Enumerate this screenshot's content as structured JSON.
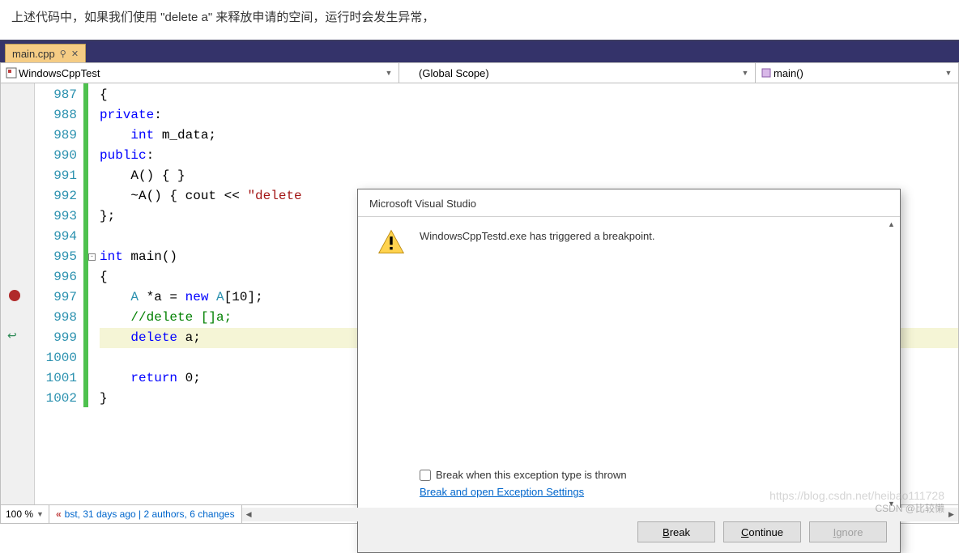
{
  "caption": "上述代码中，如果我们使用 \"delete a\" 来释放申请的空间，运行时会发生异常，",
  "tab": {
    "name": "main.cpp",
    "pin": "‫",
    "close": "✕"
  },
  "context": {
    "project_icon": "▣",
    "project": "WindowsCppTest",
    "scope": "(Global Scope)",
    "func_icon": "◈",
    "func": "main()"
  },
  "gutter": {
    "breakpoint_line": 997,
    "return_line": 999,
    "first_line": 987
  },
  "code_lines": [
    {
      "n": 987,
      "html": "{"
    },
    {
      "n": 988,
      "html": "<span class='kw'>private</span>:"
    },
    {
      "n": 989,
      "html": "    <span class='kw'>int</span> m_data;"
    },
    {
      "n": 990,
      "html": "<span class='kw'>public</span>:"
    },
    {
      "n": 991,
      "html": "    A() { }"
    },
    {
      "n": 992,
      "html": "    ~A() { cout << <span class='str'>\"delete</span>"
    },
    {
      "n": 993,
      "html": "};"
    },
    {
      "n": 994,
      "html": ""
    },
    {
      "n": 995,
      "html": "<span class='kw'>int</span> main()",
      "outline": "⊟"
    },
    {
      "n": 996,
      "html": "{"
    },
    {
      "n": 997,
      "html": "    <span class='type'>A</span> *a = <span class='kw'>new</span> <span class='type'>A</span>[10];"
    },
    {
      "n": 998,
      "html": "    <span class='cm'>//delete []a;</span>"
    },
    {
      "n": 999,
      "html": "    <span class='kw'>delete</span> a;",
      "hl": true
    },
    {
      "n": 1000,
      "html": ""
    },
    {
      "n": 1001,
      "html": "    <span class='kw'>return</span> 0;"
    },
    {
      "n": 1002,
      "html": "}"
    }
  ],
  "dialog": {
    "title": "Microsoft Visual Studio",
    "message": "WindowsCppTestd.exe has triggered a breakpoint.",
    "checkbox": "Break when this exception type is thrown",
    "link": "Break and open Exception Settings",
    "btn_break": "Break",
    "btn_continue": "Continue",
    "btn_ignore": "Ignore"
  },
  "status": {
    "zoom": "100 %",
    "codelens": "bst, 31 days ago | 2 authors, 6 changes"
  },
  "watermark1": "https://blog.csdn.net/heibao111728",
  "watermark2": "CSDN @比较懒"
}
